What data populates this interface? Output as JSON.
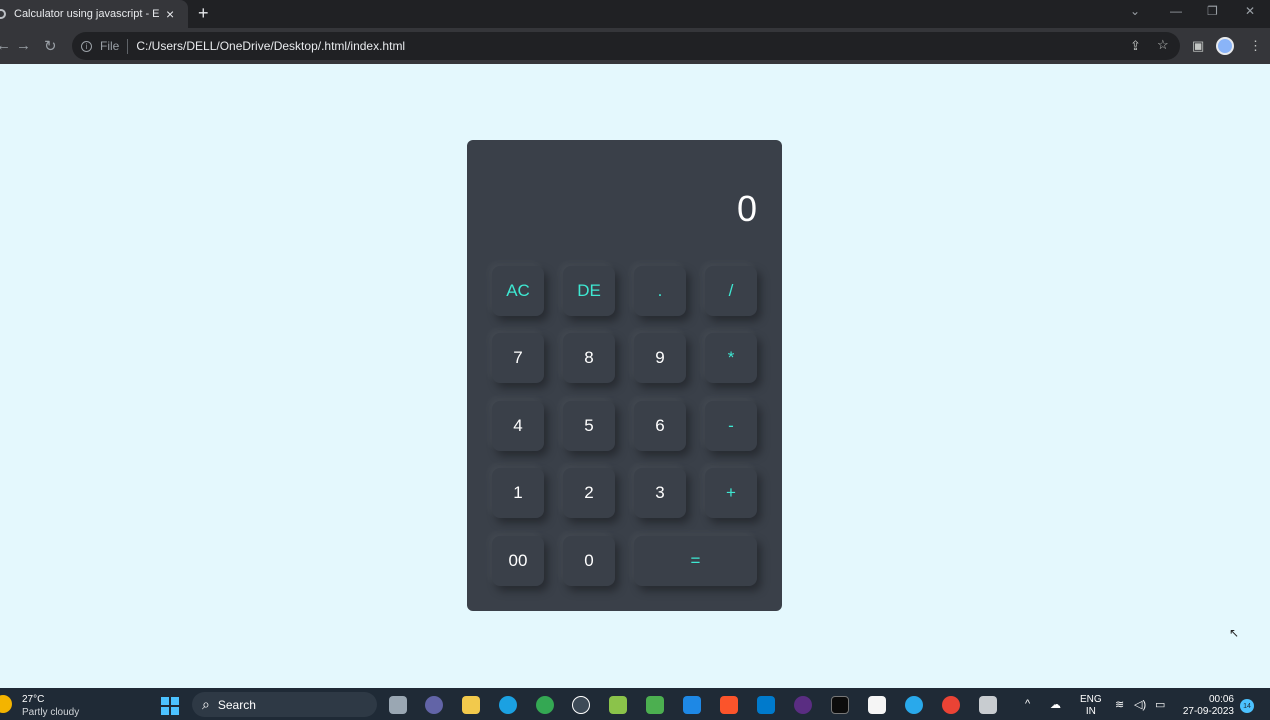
{
  "browser": {
    "tab_title": "Calculator using javascript - Easy",
    "url_scheme": "File",
    "url": "C:/Users/DELL/OneDrive/Desktop/.html/index.html"
  },
  "calculator": {
    "display": "0",
    "keys": {
      "ac": "AC",
      "de": "DE",
      "dot": ".",
      "divide": "/",
      "seven": "7",
      "eight": "8",
      "nine": "9",
      "multiply": "*",
      "four": "4",
      "five": "5",
      "six": "6",
      "minus": "-",
      "one": "1",
      "two": "2",
      "three": "3",
      "plus": "+",
      "double_zero": "00",
      "zero": "0",
      "equals": "="
    },
    "colors": {
      "body": "#3a4049",
      "operator": "#3ee8d2",
      "digit": "#ffffff",
      "page": "#e4f8fd"
    }
  },
  "taskbar": {
    "temperature": "27°C",
    "weather": "Partly cloudy",
    "search_label": "Search",
    "language_top": "ENG",
    "language_bottom": "IN",
    "time": "00:06",
    "date": "27-09-2023",
    "notification_count": "14"
  }
}
